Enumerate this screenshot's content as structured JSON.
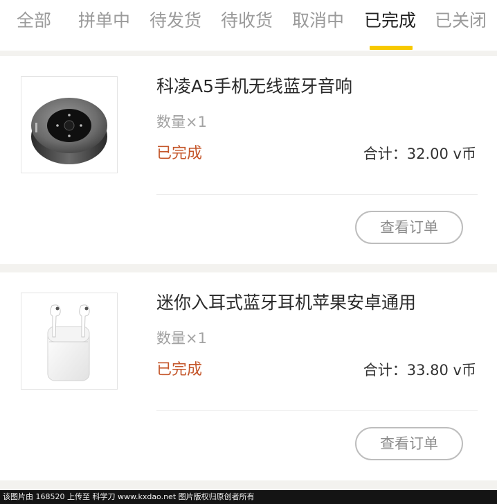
{
  "tabs": [
    {
      "label": "全部"
    },
    {
      "label": "拼单中"
    },
    {
      "label": "待发货"
    },
    {
      "label": "待收货"
    },
    {
      "label": "取消中"
    },
    {
      "label": "已完成",
      "active": true
    },
    {
      "label": "已关闭"
    }
  ],
  "colors": {
    "accent": "#f7c900",
    "status": "#c4562a",
    "background": "#f3f2ef"
  },
  "orders": [
    {
      "image_icon": "bluetooth-speaker-image",
      "title": "科凌A5手机无线蓝牙音响",
      "quantity": "数量×1",
      "status": "已完成",
      "total": "合计：32.00 v币",
      "button_label": "查看订单"
    },
    {
      "image_icon": "earbuds-image",
      "title": "迷你入耳式蓝牙耳机苹果安卓通用",
      "quantity": "数量×1",
      "status": "已完成",
      "total": "合计：33.80 v币",
      "button_label": "查看订单"
    }
  ],
  "footer": {
    "watermark": "该图片由 168520 上传至 科学刀 www.kxdao.net 图片版权归原创者所有"
  }
}
